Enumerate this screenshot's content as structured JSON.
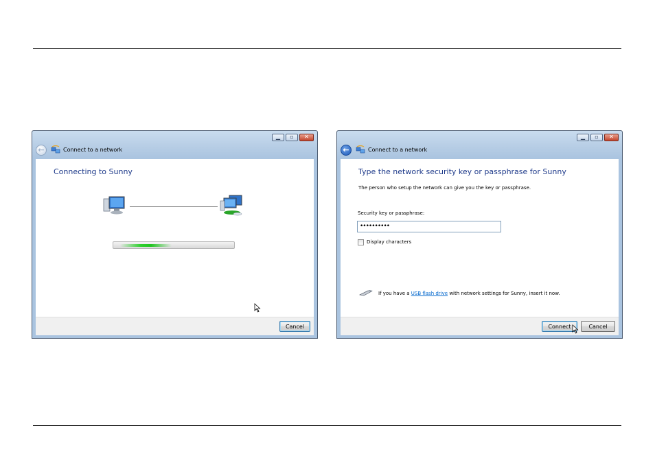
{
  "left_window": {
    "title": "Connect to a network",
    "heading": "Connecting to Sunny",
    "progress_percent": 40,
    "cancel_label": "Cancel"
  },
  "right_window": {
    "title": "Connect to a network",
    "heading": "Type the network security key or passphrase for Sunny",
    "description": "The person who setup the network can give you the key or passphrase.",
    "field_label": "Security key or passphrase:",
    "field_value": "••••••••••",
    "checkbox_label": "Display characters",
    "usb_text_before": "If you have a ",
    "usb_link": "USB flash drive",
    "usb_text_after": " with network settings for Sunny, insert it now.",
    "connect_label": "Connect",
    "cancel_label": "Cancel"
  },
  "icons": [
    "back-arrow-icon",
    "network-icon",
    "computer-icon",
    "network-computers-icon",
    "usb-drive-icon",
    "mouse-cursor-icon",
    "minimize-icon",
    "maximize-icon",
    "close-icon"
  ],
  "colors": {
    "heading": "#1e3a8a",
    "link": "#0066cc",
    "progress": "#2fd02f"
  }
}
